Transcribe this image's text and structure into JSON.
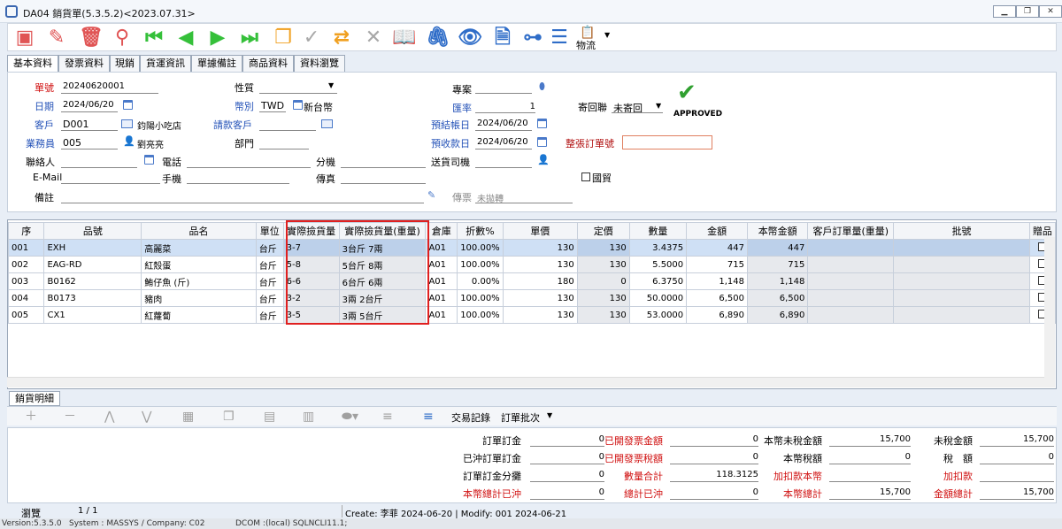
{
  "window": {
    "title": "DA04 銷貨單(5.3.5.2)<2023.07.31>",
    "min": "▁",
    "max": "❐",
    "close": "✕"
  },
  "toolbar": {
    "wuliu_label": "物流"
  },
  "tabs": [
    "基本資料",
    "發票資料",
    "現銷",
    "貨運資訊",
    "單據備註",
    "商品資料",
    "資料瀏覽"
  ],
  "form": {
    "danhao_label": "單號",
    "danhao": "20240620001",
    "riqi_label": "日期",
    "riqi": "2024/06/20",
    "kehu_label": "客戶",
    "kehu_code": "D001",
    "kehu_name": "鈞陽小吃店",
    "yewuyuan_label": "業務員",
    "yewuyuan_code": "005",
    "yewuyuan_name": "劉亮亮",
    "lianluoren_label": "聯絡人",
    "email_label": "E-Mail",
    "beizhu_label": "備註",
    "xingzhi_label": "性質",
    "bibie_label": "幣別",
    "bibie_code": "TWD",
    "bibie_name": "新台幣",
    "qingkuan_label": "請款客戶",
    "bumen_label": "部門",
    "dianhua_label": "電話",
    "shouji_label": "手機",
    "fenji_label": "分機",
    "chuanzhen_label": "傳真",
    "zhuanan_label": "專案",
    "huilv_label": "匯率",
    "huilv": "1",
    "yujie_label": "預結帳日",
    "yujie": "2024/06/20",
    "yushou_label": "預收款日",
    "yushou": "2024/06/20",
    "songhuo_label": "送貨司機",
    "chuanpiao_label": "傳票",
    "chuanpiao": "未拋轉",
    "jihuilian_label": "寄回聯",
    "jihuilian": "未寄回",
    "zhengzhang_label": "整張訂單號",
    "guomao_label": "國貿",
    "approved": "APPROVED"
  },
  "grid": {
    "headers": [
      "序",
      "品號",
      "品名",
      "單位",
      "實際撿貨量",
      "實際撿貨量(重量)",
      "倉庫",
      "折數%",
      "單價",
      "定價",
      "數量",
      "金額",
      "本幣金額",
      "客戶訂單量(重量)",
      "批號",
      "贈品"
    ],
    "rows": [
      {
        "seq": "001",
        "code": "EXH",
        "name": "高麗菜",
        "unit": "台斤",
        "pick": "3-7",
        "pickw": "3台斤 7兩",
        "wh": "A01",
        "disc": "100.00%",
        "price": "130",
        "list": "130",
        "qty": "3.4375",
        "amt": "447",
        "lamt": "447",
        "selected": true
      },
      {
        "seq": "002",
        "code": "EAG-RD",
        "name": "紅殼蛋",
        "unit": "台斤",
        "pick": "5-8",
        "pickw": "5台斤 8兩",
        "wh": "A01",
        "disc": "100.00%",
        "price": "130",
        "list": "130",
        "qty": "5.5000",
        "amt": "715",
        "lamt": "715",
        "selected": false
      },
      {
        "seq": "003",
        "code": "B0162",
        "name": "鮪仔魚 (斤)",
        "unit": "台斤",
        "pick": "6-6",
        "pickw": "6台斤 6兩",
        "wh": "A01",
        "disc": "0.00%",
        "price": "180",
        "list": "0",
        "qty": "6.3750",
        "amt": "1,148",
        "lamt": "1,148",
        "selected": false
      },
      {
        "seq": "004",
        "code": "B0173",
        "name": "豬肉",
        "unit": "台斤",
        "pick": "3-2",
        "pickw": "3兩 2台斤",
        "wh": "A01",
        "disc": "100.00%",
        "price": "130",
        "list": "130",
        "qty": "50.0000",
        "amt": "6,500",
        "lamt": "6,500",
        "selected": false
      },
      {
        "seq": "005",
        "code": "CX1",
        "name": "紅蘿蔔",
        "unit": "台斤",
        "pick": "3-5",
        "pickw": "3兩 5台斤",
        "wh": "A01",
        "disc": "100.00%",
        "price": "130",
        "list": "130",
        "qty": "53.0000",
        "amt": "6,890",
        "lamt": "6,890",
        "selected": false
      }
    ]
  },
  "subtab": "銷貨明細",
  "subtool": {
    "jiaoyi": "交易記錄",
    "dingdan": "訂單批次"
  },
  "totals": [
    {
      "l": "訂單訂金",
      "v": "0",
      "l2": "已開發票金額",
      "v2": "0",
      "l3": "本幣未稅金額",
      "v3": "15,700",
      "l4": "未稅金額",
      "v4": "15,700"
    },
    {
      "l": "已沖訂單訂金",
      "v": "0",
      "l2": "已開發票稅額",
      "v2": "0",
      "l3": "本幣稅額",
      "v3": "0",
      "l4": "稅　額",
      "v4": "0"
    },
    {
      "l": "訂單訂金分攤",
      "v": "0",
      "l2": "數量合計",
      "v2": "118.3125",
      "l3": "加扣款本幣",
      "v3": "",
      "l4": "加扣款",
      "v4": ""
    },
    {
      "l": "本幣總計已沖",
      "v": "0",
      "l2": "總計已沖",
      "v2": "0",
      "l3": "本幣總計",
      "v3": "15,700",
      "l4": "金額總計",
      "v4": "15,700"
    }
  ],
  "status": {
    "mode": "瀏覽",
    "page": "1 / 1",
    "create": "Create: 李菲 2024-06-20 | Modify: 001 2024-06-21"
  },
  "bottom": {
    "version": "Version:5.3.5.0",
    "system": "System : MASSYS  / Company: C02",
    "dcom": "DCOM :(local) SQLNCLI11.1;"
  }
}
